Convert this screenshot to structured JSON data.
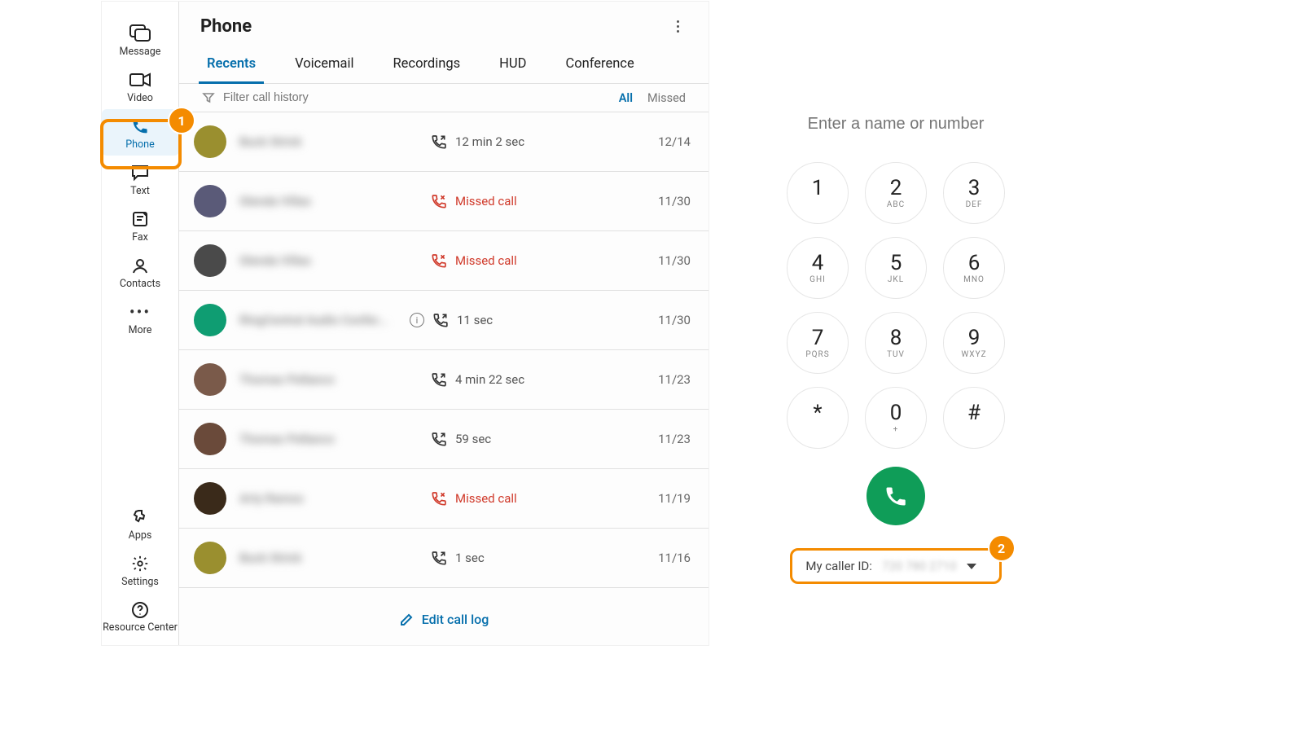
{
  "sidebar": {
    "items": [
      {
        "label": "Message"
      },
      {
        "label": "Video"
      },
      {
        "label": "Phone"
      },
      {
        "label": "Text"
      },
      {
        "label": "Fax"
      },
      {
        "label": "Contacts"
      },
      {
        "label": "More"
      }
    ],
    "footer": [
      {
        "label": "Apps"
      },
      {
        "label": "Settings"
      },
      {
        "label": "Resource Center"
      }
    ]
  },
  "header": {
    "title": "Phone"
  },
  "tabs": [
    "Recents",
    "Voicemail",
    "Recordings",
    "HUD",
    "Conference"
  ],
  "filter": {
    "placeholder": "Filter call history",
    "options": [
      "All",
      "Missed"
    ]
  },
  "calls": [
    {
      "name": "Buck Strick",
      "status": "12 min 2 sec",
      "kind": "out",
      "date": "12/14",
      "avatar": "#9a8f2f"
    },
    {
      "name": "Glenda Villas",
      "status": "Missed call",
      "kind": "missed",
      "date": "11/30",
      "avatar": "#5a5a78"
    },
    {
      "name": "Glenda Villas",
      "status": "Missed call",
      "kind": "missed",
      "date": "11/30",
      "avatar": "#4a4a4a"
    },
    {
      "name": "RingCentral Audio Confer...",
      "status": "11 sec",
      "kind": "out",
      "date": "11/30",
      "avatar": "#0f9d72",
      "info": true
    },
    {
      "name": "Thomas Pellanco",
      "status": "4 min 22 sec",
      "kind": "out",
      "date": "11/23",
      "avatar": "#7a5a4a"
    },
    {
      "name": "Thomas Pellanco",
      "status": "59 sec",
      "kind": "out",
      "date": "11/23",
      "avatar": "#6a4a3a"
    },
    {
      "name": "Arty Ramos",
      "status": "Missed call",
      "kind": "missed",
      "date": "11/19",
      "avatar": "#3a2a1a"
    },
    {
      "name": "Buck Strick",
      "status": "1 sec",
      "kind": "out",
      "date": "11/16",
      "avatar": "#9a8f2f"
    }
  ],
  "footer_action": "Edit call log",
  "dialer": {
    "placeholder": "Enter a name or number",
    "keys": [
      {
        "d": "1",
        "l": ""
      },
      {
        "d": "2",
        "l": "ABC"
      },
      {
        "d": "3",
        "l": "DEF"
      },
      {
        "d": "4",
        "l": "GHI"
      },
      {
        "d": "5",
        "l": "JKL"
      },
      {
        "d": "6",
        "l": "MNO"
      },
      {
        "d": "7",
        "l": "PQRS"
      },
      {
        "d": "8",
        "l": "TUV"
      },
      {
        "d": "9",
        "l": "WXYZ"
      },
      {
        "d": "*",
        "l": ""
      },
      {
        "d": "0",
        "l": "+"
      },
      {
        "d": "#",
        "l": ""
      }
    ],
    "caller_id_label": "My caller ID:",
    "caller_id_value": "720 780 2710"
  },
  "steps": {
    "1": "1",
    "2": "2"
  }
}
